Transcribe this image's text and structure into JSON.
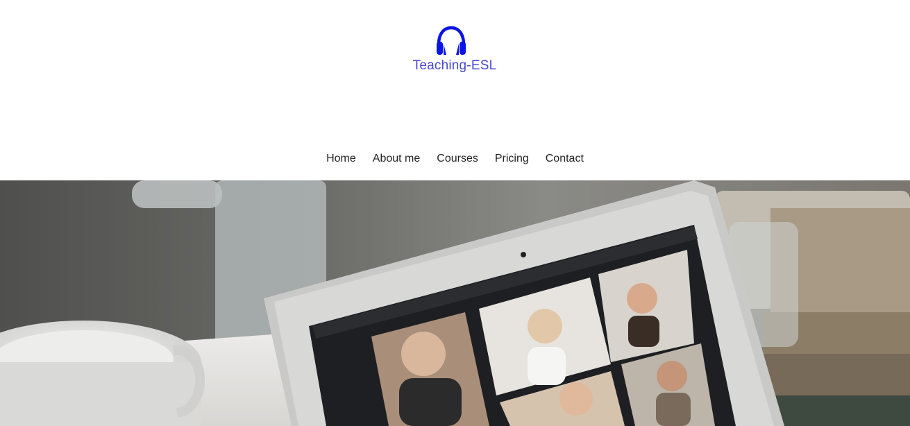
{
  "brand": {
    "name": "Teaching-ESL",
    "icon": "headphones-icon",
    "color": "#0a14e6"
  },
  "nav": {
    "items": [
      {
        "label": "Home"
      },
      {
        "label": "About me"
      },
      {
        "label": "Courses"
      },
      {
        "label": "Pricing"
      },
      {
        "label": "Contact"
      }
    ]
  },
  "hero": {
    "image": "laptop-video-call-photo"
  }
}
